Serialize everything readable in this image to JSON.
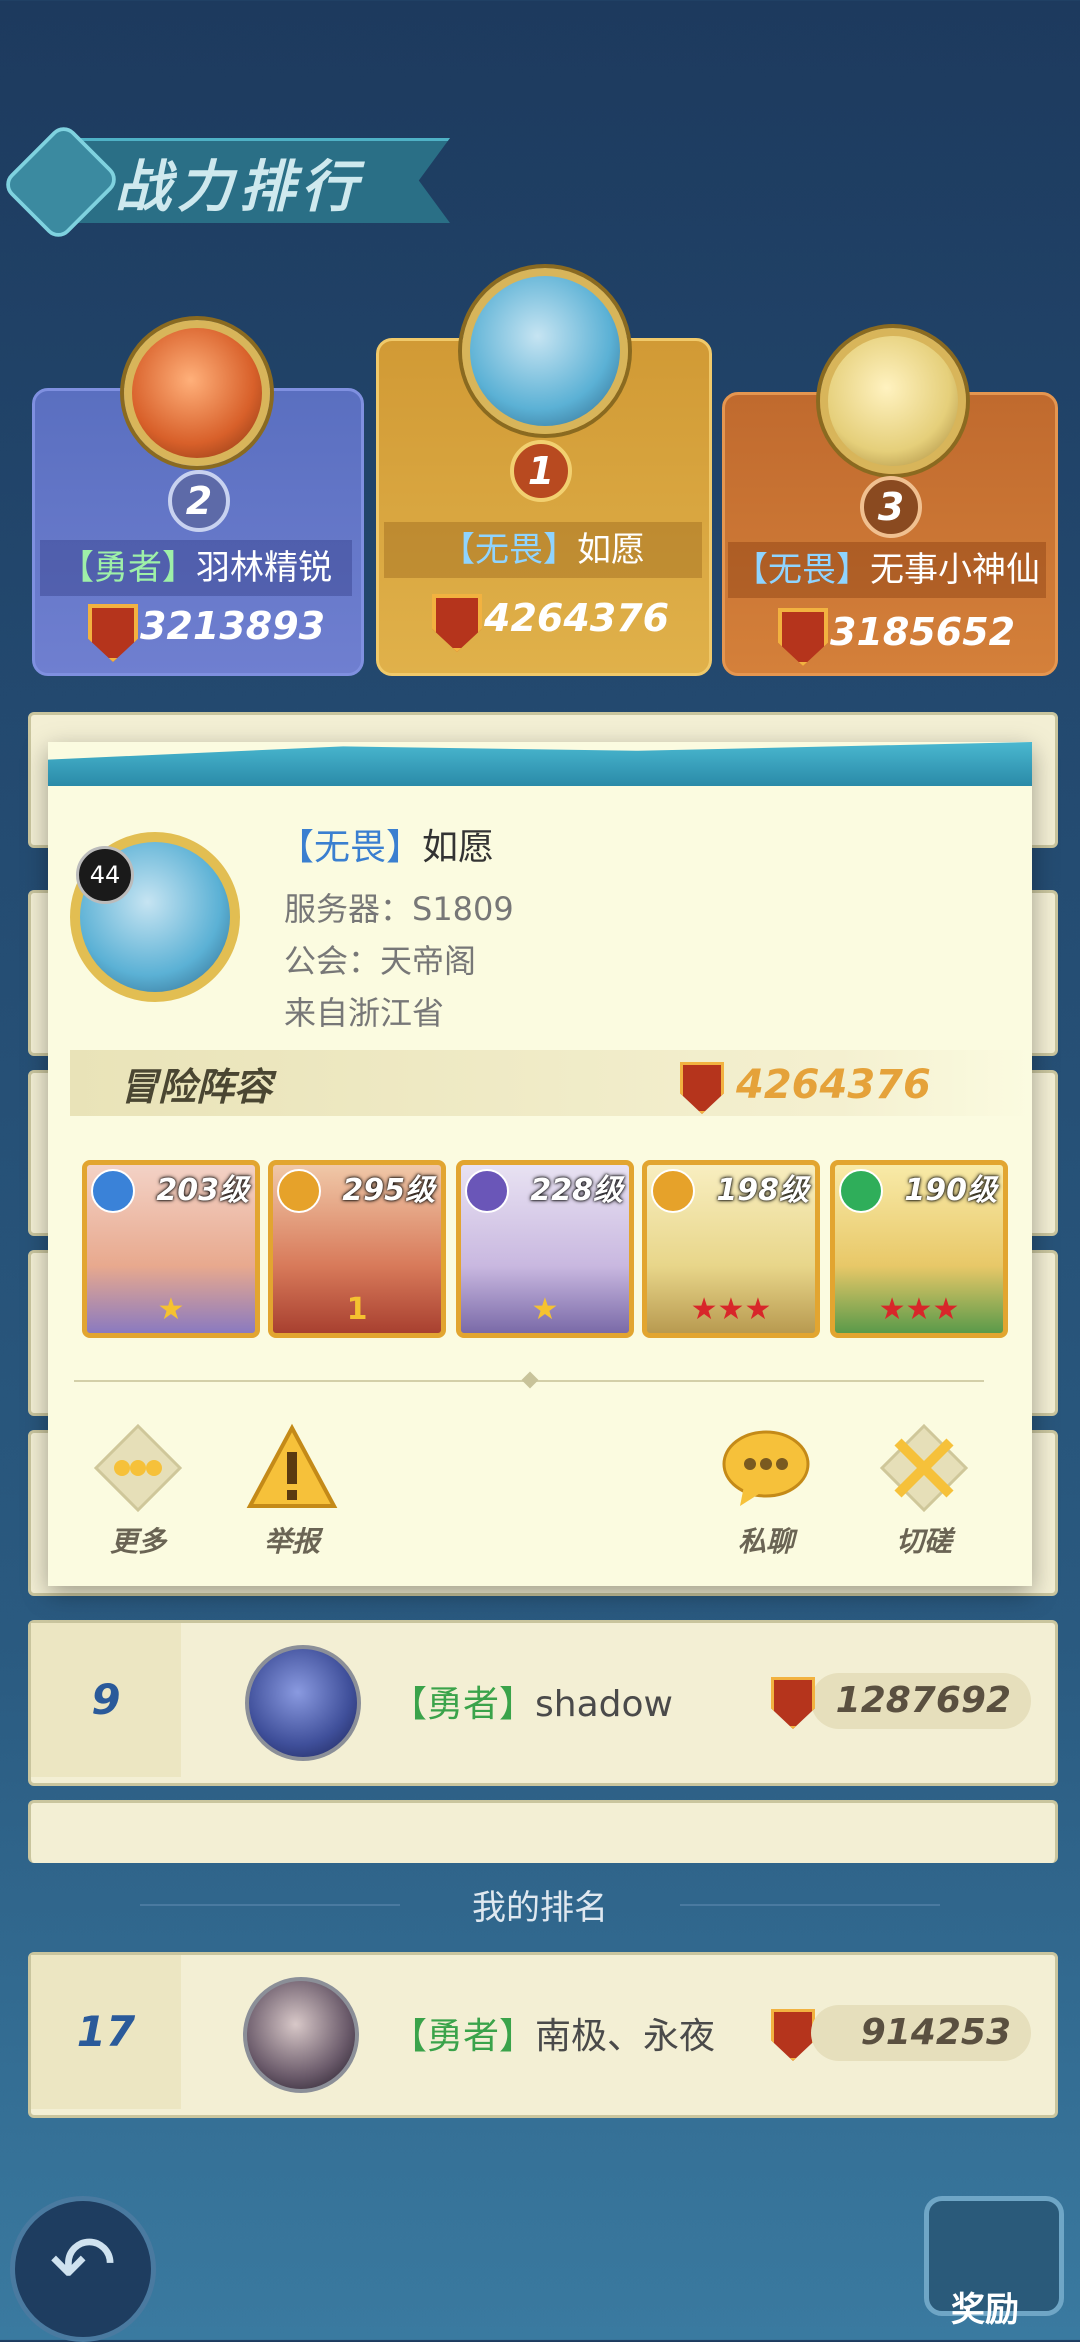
{
  "header": {
    "title": "战力排行"
  },
  "podium": [
    {
      "rank": "2",
      "guild": "【勇者】",
      "name": "羽林精锐",
      "power": "3213893"
    },
    {
      "rank": "1",
      "guild": "【无畏】",
      "name": "如愿",
      "power": "4264376"
    },
    {
      "rank": "3",
      "guild": "【无畏】",
      "name": "无事小神仙",
      "power": "3185652"
    }
  ],
  "list": [
    {
      "rank": "9",
      "guild": "【勇者】",
      "name": "shadow",
      "power": "1287692"
    }
  ],
  "popup": {
    "level": "44",
    "guild": "【无畏】",
    "name": "如愿",
    "server": "服务器：S1809",
    "union": "公会：天帝阁",
    "origin": "来自浙江省",
    "lineup_title": "冒险阵容",
    "lineup_power": "4264376",
    "heroes": [
      {
        "level": "203级",
        "stars": "★",
        "elem_color": "#3a82d8"
      },
      {
        "level": "295级",
        "stars": "1",
        "elem_color": "#e6a22a"
      },
      {
        "level": "228级",
        "stars": "★",
        "elem_color": "#6a56b8"
      },
      {
        "level": "198级",
        "stars": "★★★",
        "elem_color": "#e6a22a"
      },
      {
        "level": "190级",
        "stars": "★★★",
        "elem_color": "#2fae5a"
      }
    ],
    "actions": {
      "more": "更多",
      "report": "举报",
      "chat": "私聊",
      "duel": "切磋"
    }
  },
  "my_rank": {
    "label": "我的排名",
    "rank": "17",
    "guild": "【勇者】",
    "name": "南极、永夜",
    "power": "914253"
  },
  "footer": {
    "back_icon": "back-arrow-icon",
    "reward_label": "奖励"
  }
}
